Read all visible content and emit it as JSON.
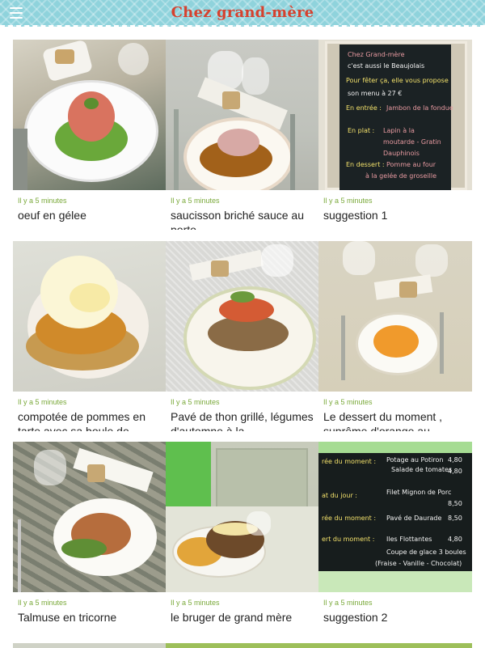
{
  "header": {
    "title": "Chez grand-mère",
    "menu_icon": "hamburger-menu-icon"
  },
  "colors": {
    "header_bg": "#8fd3dc",
    "title": "#d6412e",
    "timestamp": "#7aa93a"
  },
  "posts": [
    {
      "time": "Il y a 5 minutes",
      "title": "oeuf en gélee"
    },
    {
      "time": "Il y a 5 minutes",
      "title": "saucisson briché sauce au porto"
    },
    {
      "time": "Il y a 5 minutes",
      "title": "suggestion 1"
    },
    {
      "time": "Il y a 5 minutes",
      "title": "compotée de pommes en tarte avec sa boule de"
    },
    {
      "time": "Il y a 5 minutes",
      "title": "Pavé de thon grillé, légumes d'automne à la"
    },
    {
      "time": "Il y a 5 minutes",
      "title": "Le dessert du moment , suprême d'orange au"
    },
    {
      "time": "Il y a 5 minutes",
      "title": "Talmuse en tricorne"
    },
    {
      "time": "Il y a 5 minutes",
      "title": "le bruger de grand mère"
    },
    {
      "time": "Il y a 5 minutes",
      "title": "suggestion 2"
    }
  ]
}
